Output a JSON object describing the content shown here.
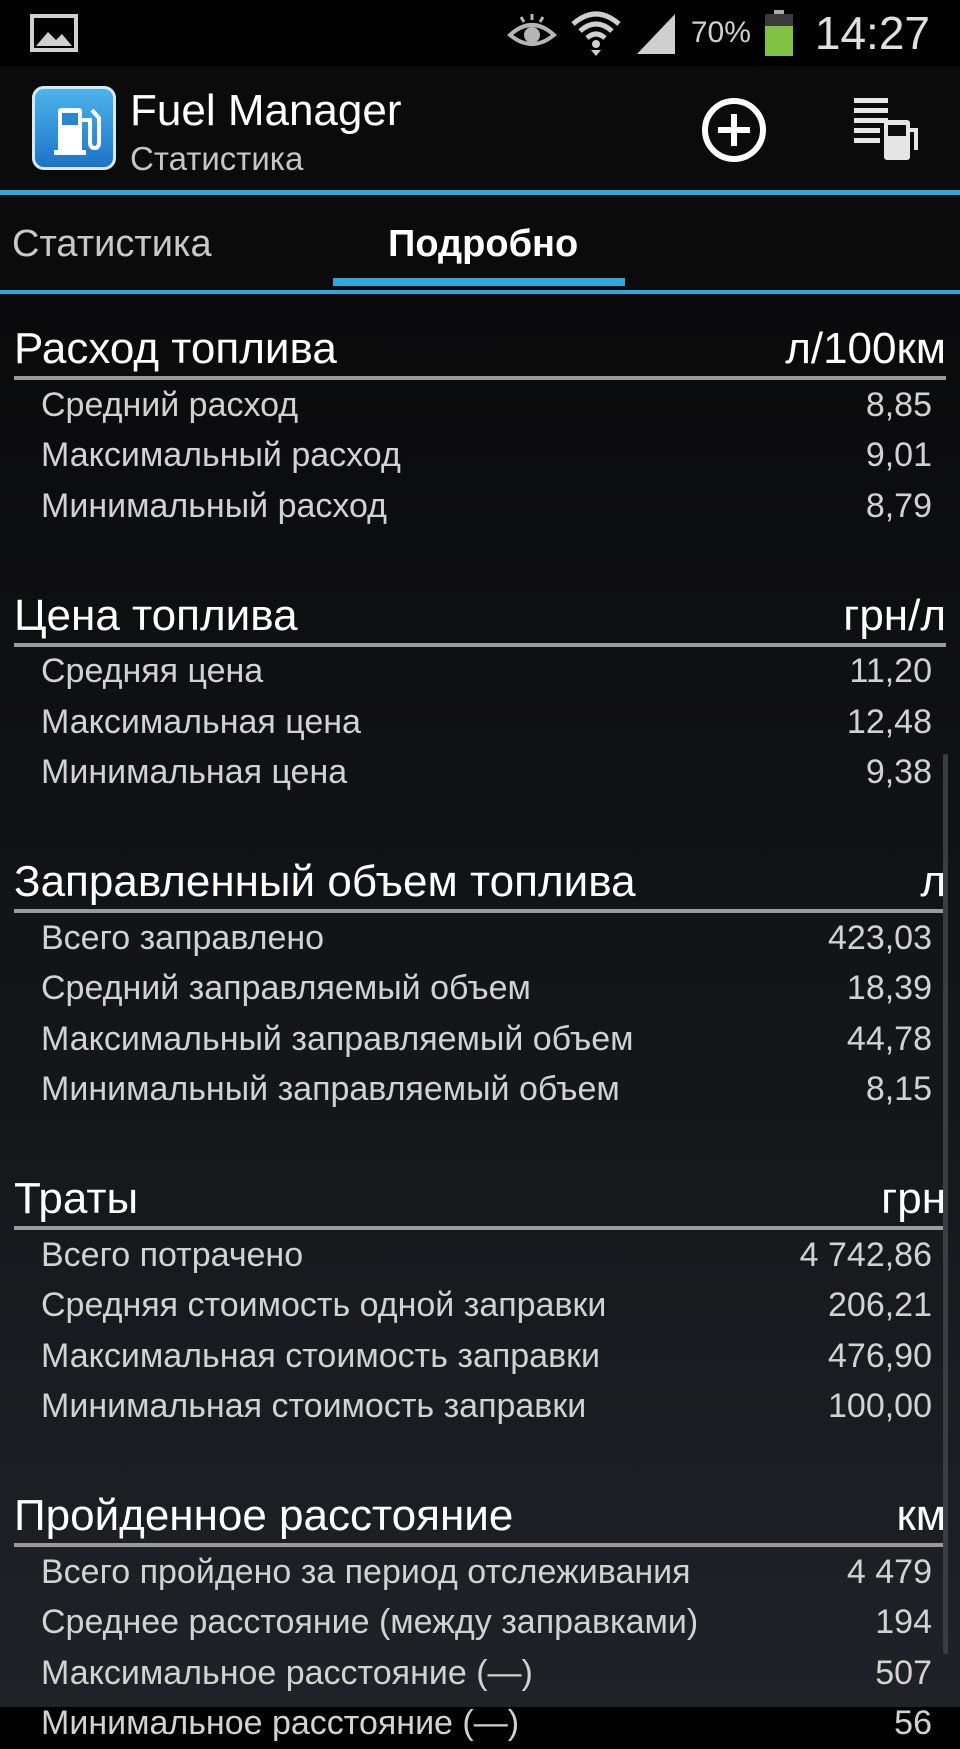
{
  "status_bar": {
    "battery_percent": "70%",
    "time": "14:27",
    "icons": [
      "gallery-icon",
      "eye-icon",
      "wifi-icon",
      "signal-icon",
      "battery-icon"
    ]
  },
  "app": {
    "title": "Fuel Manager",
    "subtitle": "Статистика",
    "accent_color": "#2fa6dc",
    "actions": [
      "add-icon",
      "fuel-list-icon"
    ]
  },
  "tabs": [
    {
      "label": "Статистика",
      "selected": false
    },
    {
      "label": "Подробно",
      "selected": true
    }
  ],
  "sections": [
    {
      "title": "Расход топлива",
      "unit": "л/100км",
      "rows": [
        {
          "label": "Средний расход",
          "value": "8,85"
        },
        {
          "label": "Максимальный расход",
          "value": "9,01"
        },
        {
          "label": "Минимальный расход",
          "value": "8,79"
        }
      ]
    },
    {
      "title": "Цена топлива",
      "unit": "грн/л",
      "rows": [
        {
          "label": "Средняя цена",
          "value": "11,20"
        },
        {
          "label": "Максимальная цена",
          "value": "12,48"
        },
        {
          "label": "Минимальная цена",
          "value": "9,38"
        }
      ]
    },
    {
      "title": "Заправленный объем топлива",
      "unit": "л",
      "rows": [
        {
          "label": "Всего заправлено",
          "value": "423,03"
        },
        {
          "label": "Средний заправляемый объем",
          "value": "18,39"
        },
        {
          "label": "Максимальный заправляемый объем",
          "value": "44,78"
        },
        {
          "label": "Минимальный заправляемый объем",
          "value": "8,15"
        }
      ]
    },
    {
      "title": "Траты",
      "unit": "грн",
      "rows": [
        {
          "label": "Всего потрачено",
          "value": "4 742,86"
        },
        {
          "label": "Средняя стоимость одной заправки",
          "value": "206,21"
        },
        {
          "label": "Максимальная стоимость заправки",
          "value": "476,90"
        },
        {
          "label": "Минимальная стоимость заправки",
          "value": "100,00"
        }
      ]
    },
    {
      "title": "Пройденное расстояние",
      "unit": "км",
      "rows": [
        {
          "label": "Всего пройдено за период отслеживания",
          "value": "4 479"
        },
        {
          "label": "Среднее расстояние (между заправками)",
          "value": "194"
        },
        {
          "label": "Максимальное расстояние (—)",
          "value": "507"
        },
        {
          "label": "Минимальное расстояние (—)",
          "value": "56"
        }
      ]
    }
  ]
}
